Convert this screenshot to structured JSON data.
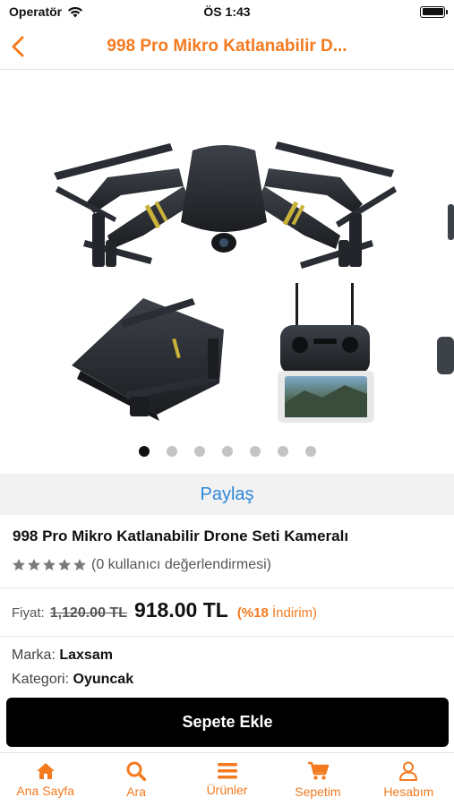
{
  "status": {
    "carrier": "Operatör",
    "time": "ÖS 1:43"
  },
  "nav": {
    "title": "998 Pro Mikro Katlanabilir D..."
  },
  "gallery": {
    "dot_count": 7,
    "active_index": 0
  },
  "share": {
    "label": "Paylaş"
  },
  "product": {
    "title": "998 Pro Mikro Katlanabilir Drone Seti  Kameralı",
    "rating_text": "(0 kullanıcı değerlendirmesi)",
    "rating_value": 0
  },
  "price": {
    "label": "Fiyat:",
    "old": "1,120.00 TL",
    "new": "918.00 TL",
    "discount_pct": "(%18",
    "discount_word": "İndirim)"
  },
  "meta": {
    "brand_label": "Marka:",
    "brand": "Laxsam",
    "category_label": "Kategori:",
    "category": "Oyuncak"
  },
  "cart": {
    "label": "Sepete Ekle"
  },
  "tabs": [
    {
      "label": "Ana Sayfa",
      "icon": "home-icon",
      "active": true
    },
    {
      "label": "Ara",
      "icon": "search-icon",
      "active": false
    },
    {
      "label": "Ürünler",
      "icon": "list-icon",
      "active": false
    },
    {
      "label": "Sepetim",
      "icon": "cart-icon",
      "active": false
    },
    {
      "label": "Hesabım",
      "icon": "user-icon",
      "active": false
    }
  ],
  "colors": {
    "accent": "#f47a20",
    "link": "#2b86d8",
    "button": "#000000"
  }
}
